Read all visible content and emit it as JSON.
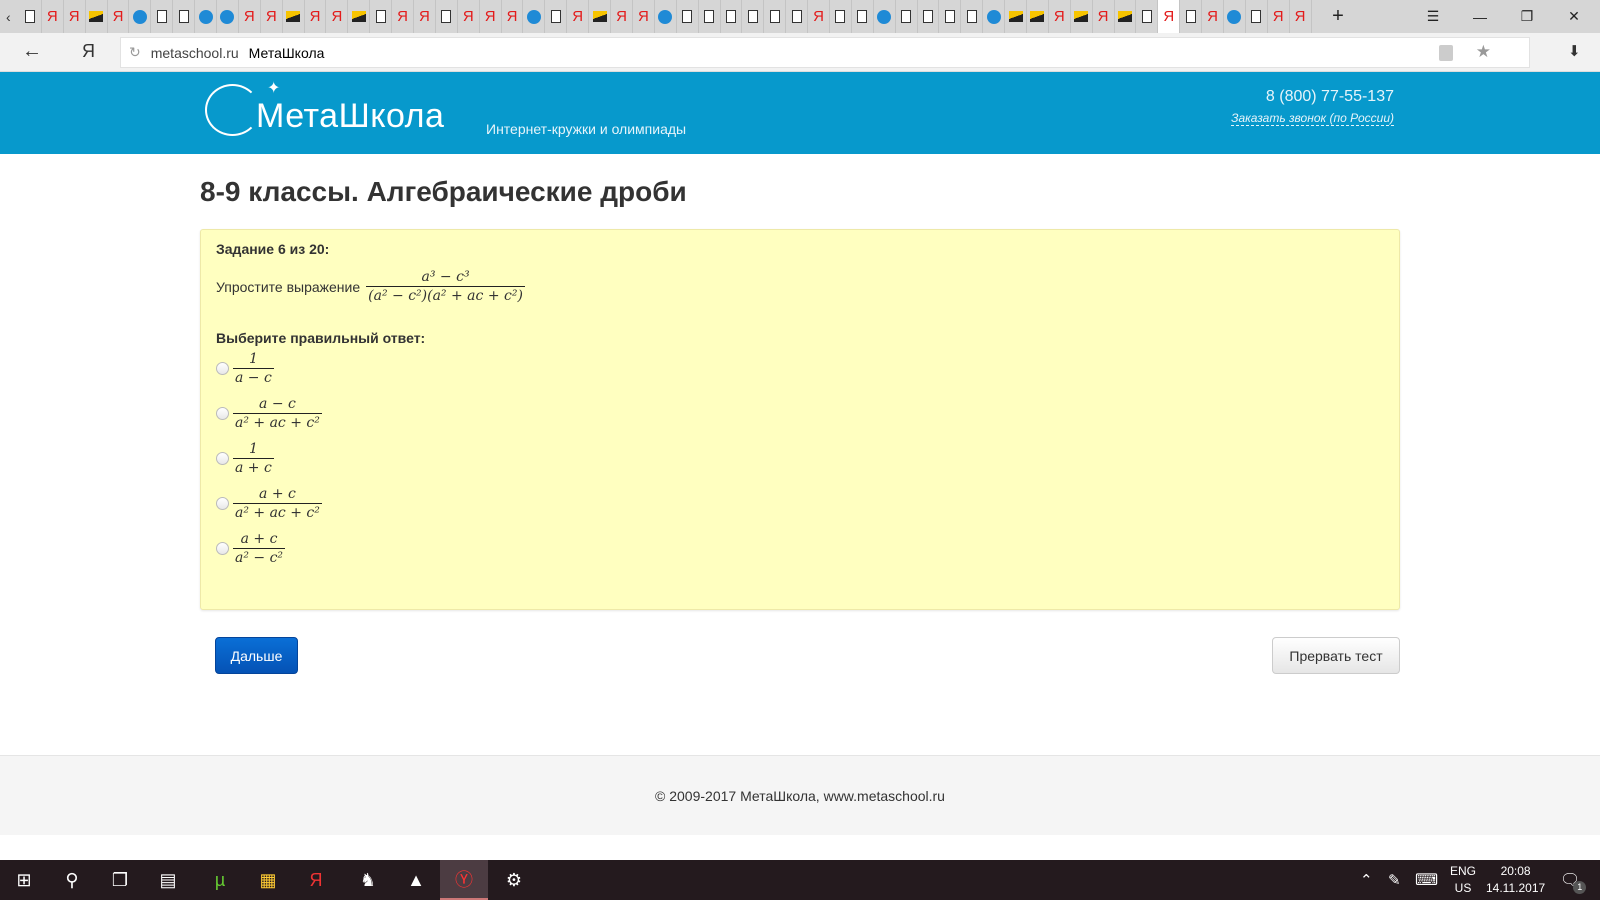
{
  "browser": {
    "tab_icons": [
      "page",
      "ya",
      "ya",
      "img",
      "ya",
      "blue",
      "page",
      "page",
      "blue",
      "blue",
      "ya",
      "ya",
      "img",
      "ya",
      "ya",
      "img",
      "page",
      "ya",
      "ya",
      "page",
      "ya",
      "ya",
      "ya",
      "blue",
      "page",
      "ya",
      "img",
      "ya",
      "ya",
      "blue",
      "page",
      "page",
      "page",
      "page",
      "page",
      "page",
      "ya",
      "page",
      "page",
      "blue",
      "page",
      "page",
      "page",
      "page",
      "blue",
      "img",
      "img",
      "ya",
      "img",
      "ya",
      "img",
      "page",
      "ya",
      "page",
      "ya",
      "blue",
      "page",
      "ya",
      "ya"
    ],
    "active_tab_index": 52,
    "new_tab": "+",
    "menu": "☰",
    "minimize": "—",
    "restore": "❐",
    "close": "✕",
    "back": "←",
    "yandex": "Я",
    "reload": "↻",
    "url": "metaschool.ru",
    "page_title": "МетаШкола",
    "star": "★",
    "download": "⬇"
  },
  "site": {
    "logo": "МетаШкола",
    "tagline": "Интернет-кружки и олимпиады",
    "phone": "8 (800) 77-55-137",
    "callback": "Заказать звонок (по России)"
  },
  "page": {
    "title": "8-9 классы. Алгебраические дроби",
    "task": "Задание 6 из 20:",
    "question_text": "Упростите выражение",
    "question_num": "a³ − c³",
    "question_den": "(a² − c²)(a² + ac + c²)",
    "choose": "Выберите правильный ответ:",
    "options": [
      {
        "num": "1",
        "den": "a − c"
      },
      {
        "num": "a − c",
        "den": "a² + ac + c²"
      },
      {
        "num": "1",
        "den": "a + c"
      },
      {
        "num": "a + c",
        "den": "a² + ac + c²"
      },
      {
        "num": "a + c",
        "den": "a² − c²"
      }
    ],
    "next": "Дальше",
    "abort": "Прервать тест"
  },
  "footer": "© 2009-2017 МетаШкола, www.metaschool.ru",
  "taskbar": {
    "lang": "ENG",
    "layout": "US",
    "time": "20:08",
    "date": "14.11.2017",
    "notifications": "1"
  }
}
